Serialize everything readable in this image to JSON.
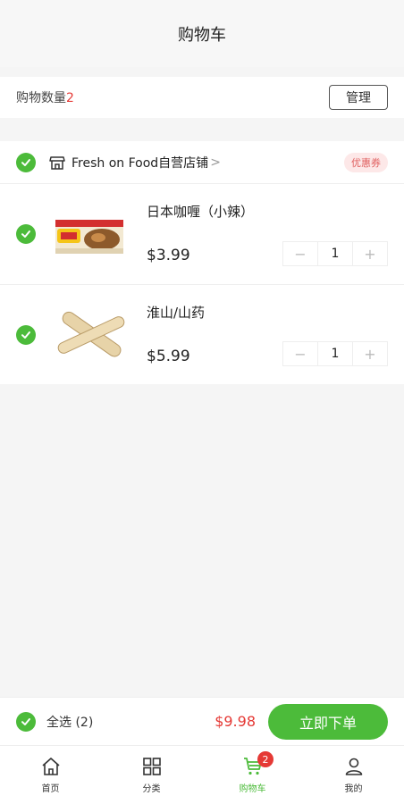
{
  "header": {
    "title": "购物车"
  },
  "count_bar": {
    "label": "购物数量",
    "count": "2",
    "manage_label": "管理"
  },
  "shop": {
    "name": "Fresh on Food自营店铺",
    "arrow": ">",
    "coupon_label": "优惠券"
  },
  "items": [
    {
      "name": "日本咖喱（小辣）",
      "price": "$3.99",
      "quantity": "1",
      "minus": "−",
      "plus": "+"
    },
    {
      "name": "淮山/山药",
      "price": "$5.99",
      "quantity": "1",
      "minus": "−",
      "plus": "+"
    }
  ],
  "checkout": {
    "select_all_label": "全选 (2)",
    "total": "$9.98",
    "order_button": "立即下单"
  },
  "tabbar": {
    "tabs": [
      {
        "label": "首页",
        "icon": "home-icon"
      },
      {
        "label": "分类",
        "icon": "grid-icon"
      },
      {
        "label": "购物车",
        "icon": "cart-icon",
        "badge": "2"
      },
      {
        "label": "我的",
        "icon": "user-icon"
      }
    ]
  },
  "colors": {
    "accent": "#4cbb3a",
    "price_red": "#e53935",
    "coupon_bg": "#fde8e8"
  }
}
